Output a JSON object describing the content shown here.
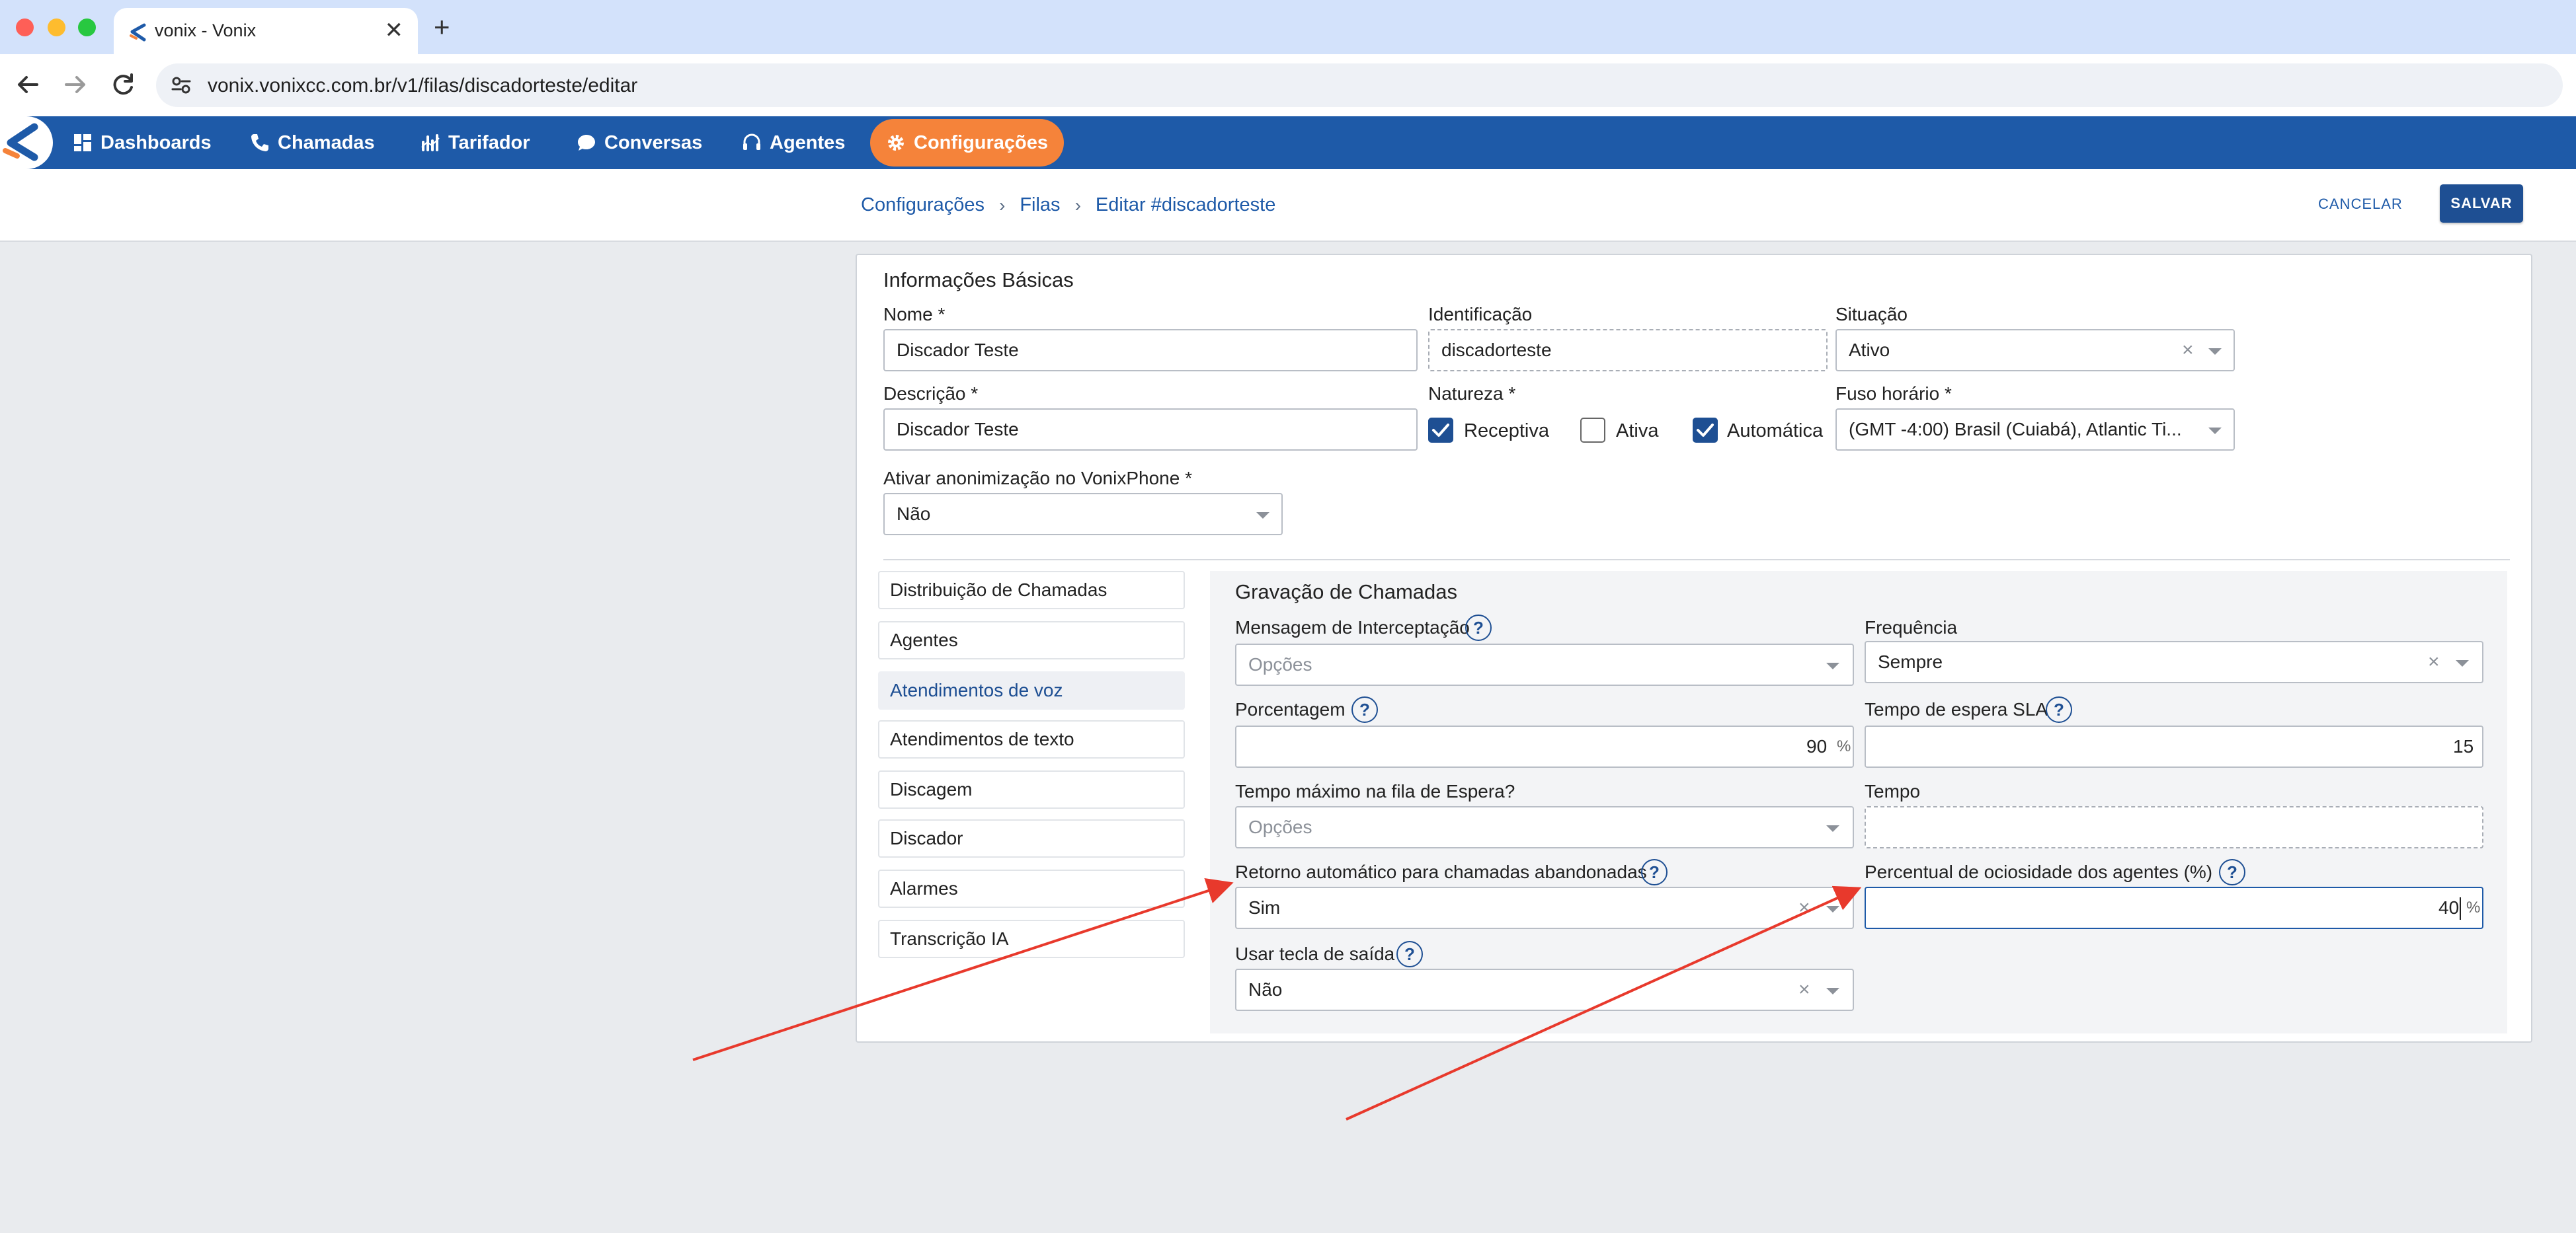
{
  "browser": {
    "tab_title": "vonix - Vonix",
    "tab_close": "✕",
    "new_tab": "+",
    "url": "vonix.vonixcc.com.br/v1/filas/discadorteste/editar"
  },
  "nav": {
    "items": [
      {
        "label": "Dashboards",
        "icon": "dashboard-icon"
      },
      {
        "label": "Chamadas",
        "icon": "phone-icon"
      },
      {
        "label": "Tarifador",
        "icon": "chart-icon"
      },
      {
        "label": "Conversas",
        "icon": "chat-icon"
      },
      {
        "label": "Agentes",
        "icon": "headset-icon"
      },
      {
        "label": "Configurações",
        "icon": "gear-icon",
        "active": true
      }
    ]
  },
  "breadcrumb": {
    "items": [
      "Configurações",
      "Filas",
      "Editar #discadorteste"
    ],
    "separator": "›"
  },
  "actions": {
    "cancel": "CANCELAR",
    "save": "SALVAR"
  },
  "basic": {
    "title": "Informações Básicas",
    "nome_label": "Nome *",
    "nome_value": "Discador Teste",
    "ident_label": "Identificação",
    "ident_value": "discadorteste",
    "situacao_label": "Situação",
    "situacao_value": "Ativo",
    "descricao_label": "Descrição *",
    "descricao_value": "Discador Teste",
    "natureza_label": "Natureza *",
    "natureza": [
      {
        "label": "Receptiva",
        "checked": true
      },
      {
        "label": "Ativa",
        "checked": false
      },
      {
        "label": "Automática",
        "checked": true
      }
    ],
    "fuso_label": "Fuso horário *",
    "fuso_value": "(GMT -4:00) Brasil (Cuiabá), Atlantic Ti...",
    "anon_label": "Ativar anonimização no VonixPhone *",
    "anon_value": "Não"
  },
  "sidebar": {
    "items": [
      {
        "label": "Distribuição de Chamadas"
      },
      {
        "label": "Agentes"
      },
      {
        "label": "Atendimentos de voz",
        "active": true
      },
      {
        "label": "Atendimentos de texto"
      },
      {
        "label": "Discagem"
      },
      {
        "label": "Discador"
      },
      {
        "label": "Alarmes"
      },
      {
        "label": "Transcrição IA"
      }
    ]
  },
  "gravacao": {
    "title": "Gravação de Chamadas",
    "help": "?",
    "msg_label": "Mensagem de Interceptação",
    "msg_placeholder": "Opções",
    "freq_label": "Frequência",
    "freq_value": "Sempre",
    "porc_label": "Porcentagem",
    "porc_value": "90",
    "porc_unit": "%",
    "sla_label": "Tempo de espera SLA",
    "sla_value": "15",
    "tmax_label": "Tempo máximo na fila de Espera?",
    "tmax_placeholder": "Opções",
    "tempo_label": "Tempo",
    "retorno_label": "Retorno automático para chamadas abandonadas",
    "retorno_value": "Sim",
    "ocio_label": "Percentual de ociosidade dos agentes (%)",
    "ocio_value": "40",
    "ocio_unit": "%",
    "saida_label": "Usar tecla de saída",
    "saida_value": "Não"
  },
  "colors": {
    "nav_bg": "#1e5aa8",
    "nav_active": "#f5833a",
    "primary": "#1e4f93",
    "annotation_arrow": "#e8392c"
  }
}
